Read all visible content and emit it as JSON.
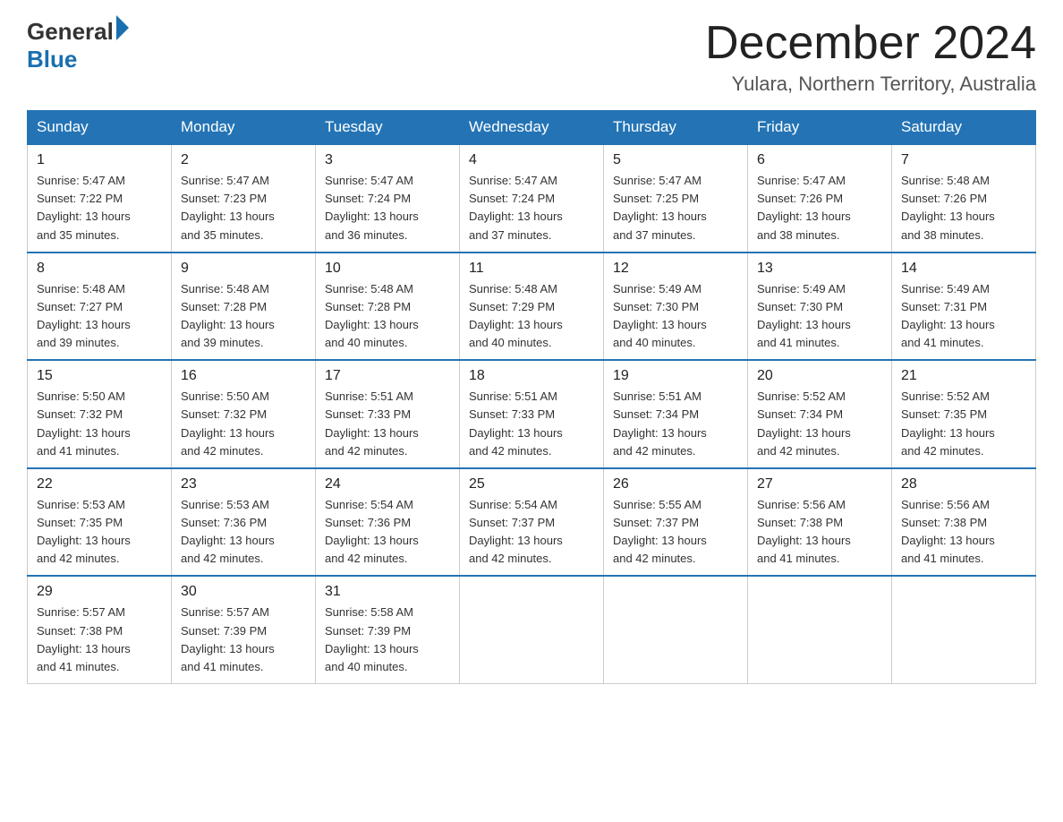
{
  "header": {
    "logo_general": "General",
    "logo_blue": "Blue",
    "month_title": "December 2024",
    "location": "Yulara, Northern Territory, Australia"
  },
  "days_of_week": [
    "Sunday",
    "Monday",
    "Tuesday",
    "Wednesday",
    "Thursday",
    "Friday",
    "Saturday"
  ],
  "weeks": [
    [
      {
        "day": "1",
        "sunrise": "5:47 AM",
        "sunset": "7:22 PM",
        "daylight": "13 hours and 35 minutes."
      },
      {
        "day": "2",
        "sunrise": "5:47 AM",
        "sunset": "7:23 PM",
        "daylight": "13 hours and 35 minutes."
      },
      {
        "day": "3",
        "sunrise": "5:47 AM",
        "sunset": "7:24 PM",
        "daylight": "13 hours and 36 minutes."
      },
      {
        "day": "4",
        "sunrise": "5:47 AM",
        "sunset": "7:24 PM",
        "daylight": "13 hours and 37 minutes."
      },
      {
        "day": "5",
        "sunrise": "5:47 AM",
        "sunset": "7:25 PM",
        "daylight": "13 hours and 37 minutes."
      },
      {
        "day": "6",
        "sunrise": "5:47 AM",
        "sunset": "7:26 PM",
        "daylight": "13 hours and 38 minutes."
      },
      {
        "day": "7",
        "sunrise": "5:48 AM",
        "sunset": "7:26 PM",
        "daylight": "13 hours and 38 minutes."
      }
    ],
    [
      {
        "day": "8",
        "sunrise": "5:48 AM",
        "sunset": "7:27 PM",
        "daylight": "13 hours and 39 minutes."
      },
      {
        "day": "9",
        "sunrise": "5:48 AM",
        "sunset": "7:28 PM",
        "daylight": "13 hours and 39 minutes."
      },
      {
        "day": "10",
        "sunrise": "5:48 AM",
        "sunset": "7:28 PM",
        "daylight": "13 hours and 40 minutes."
      },
      {
        "day": "11",
        "sunrise": "5:48 AM",
        "sunset": "7:29 PM",
        "daylight": "13 hours and 40 minutes."
      },
      {
        "day": "12",
        "sunrise": "5:49 AM",
        "sunset": "7:30 PM",
        "daylight": "13 hours and 40 minutes."
      },
      {
        "day": "13",
        "sunrise": "5:49 AM",
        "sunset": "7:30 PM",
        "daylight": "13 hours and 41 minutes."
      },
      {
        "day": "14",
        "sunrise": "5:49 AM",
        "sunset": "7:31 PM",
        "daylight": "13 hours and 41 minutes."
      }
    ],
    [
      {
        "day": "15",
        "sunrise": "5:50 AM",
        "sunset": "7:32 PM",
        "daylight": "13 hours and 41 minutes."
      },
      {
        "day": "16",
        "sunrise": "5:50 AM",
        "sunset": "7:32 PM",
        "daylight": "13 hours and 42 minutes."
      },
      {
        "day": "17",
        "sunrise": "5:51 AM",
        "sunset": "7:33 PM",
        "daylight": "13 hours and 42 minutes."
      },
      {
        "day": "18",
        "sunrise": "5:51 AM",
        "sunset": "7:33 PM",
        "daylight": "13 hours and 42 minutes."
      },
      {
        "day": "19",
        "sunrise": "5:51 AM",
        "sunset": "7:34 PM",
        "daylight": "13 hours and 42 minutes."
      },
      {
        "day": "20",
        "sunrise": "5:52 AM",
        "sunset": "7:34 PM",
        "daylight": "13 hours and 42 minutes."
      },
      {
        "day": "21",
        "sunrise": "5:52 AM",
        "sunset": "7:35 PM",
        "daylight": "13 hours and 42 minutes."
      }
    ],
    [
      {
        "day": "22",
        "sunrise": "5:53 AM",
        "sunset": "7:35 PM",
        "daylight": "13 hours and 42 minutes."
      },
      {
        "day": "23",
        "sunrise": "5:53 AM",
        "sunset": "7:36 PM",
        "daylight": "13 hours and 42 minutes."
      },
      {
        "day": "24",
        "sunrise": "5:54 AM",
        "sunset": "7:36 PM",
        "daylight": "13 hours and 42 minutes."
      },
      {
        "day": "25",
        "sunrise": "5:54 AM",
        "sunset": "7:37 PM",
        "daylight": "13 hours and 42 minutes."
      },
      {
        "day": "26",
        "sunrise": "5:55 AM",
        "sunset": "7:37 PM",
        "daylight": "13 hours and 42 minutes."
      },
      {
        "day": "27",
        "sunrise": "5:56 AM",
        "sunset": "7:38 PM",
        "daylight": "13 hours and 41 minutes."
      },
      {
        "day": "28",
        "sunrise": "5:56 AM",
        "sunset": "7:38 PM",
        "daylight": "13 hours and 41 minutes."
      }
    ],
    [
      {
        "day": "29",
        "sunrise": "5:57 AM",
        "sunset": "7:38 PM",
        "daylight": "13 hours and 41 minutes."
      },
      {
        "day": "30",
        "sunrise": "5:57 AM",
        "sunset": "7:39 PM",
        "daylight": "13 hours and 41 minutes."
      },
      {
        "day": "31",
        "sunrise": "5:58 AM",
        "sunset": "7:39 PM",
        "daylight": "13 hours and 40 minutes."
      },
      null,
      null,
      null,
      null
    ]
  ],
  "labels": {
    "sunrise_prefix": "Sunrise: ",
    "sunset_prefix": "Sunset: ",
    "daylight_prefix": "Daylight: "
  }
}
